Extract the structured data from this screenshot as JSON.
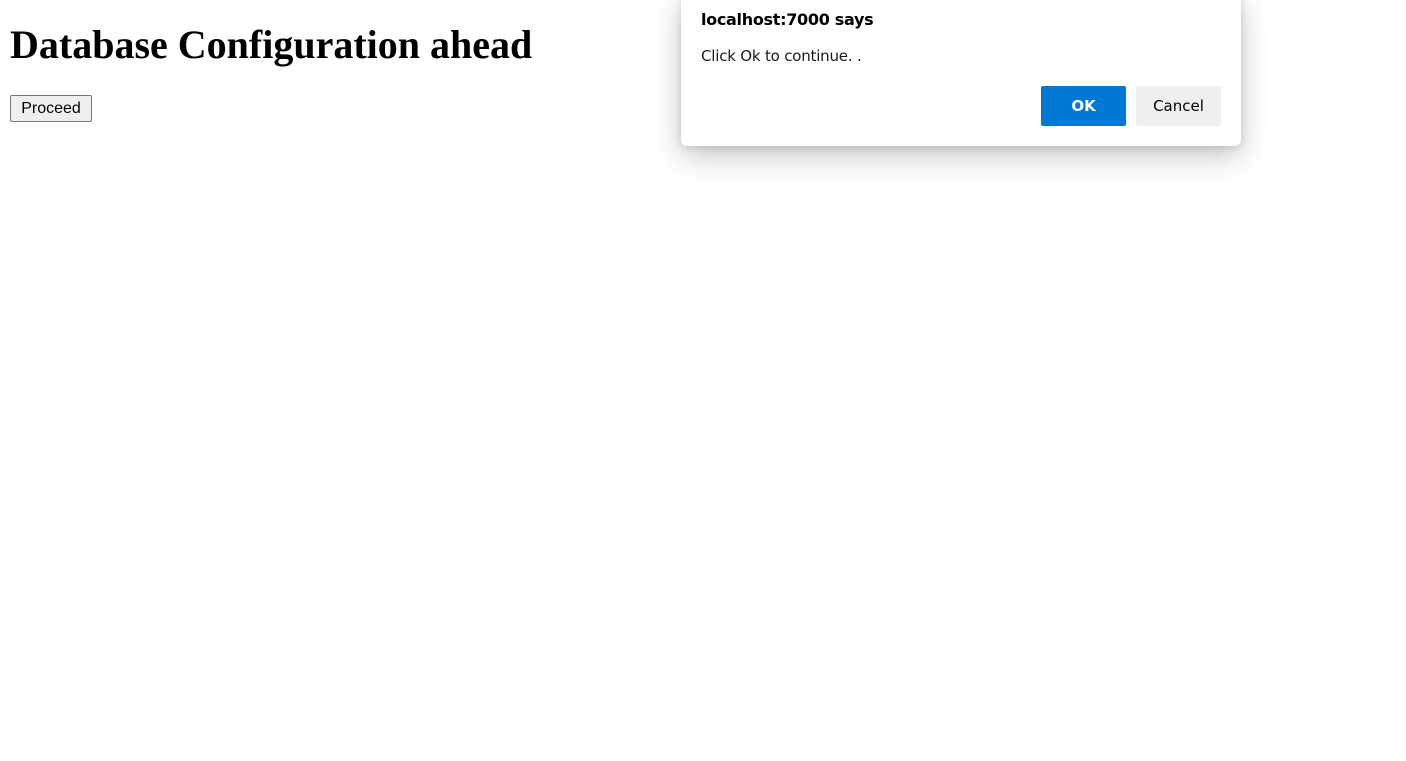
{
  "page": {
    "heading": "Database Configuration ahead",
    "proceed_label": "Proceed"
  },
  "dialog": {
    "origin": "localhost:7000 says",
    "message": "Click Ok to continue. .",
    "ok_label": "OK",
    "cancel_label": "Cancel"
  },
  "colors": {
    "ok_button_bg": "#0078d4",
    "cancel_button_bg": "#efefef",
    "page_bg": "#ffffff"
  }
}
